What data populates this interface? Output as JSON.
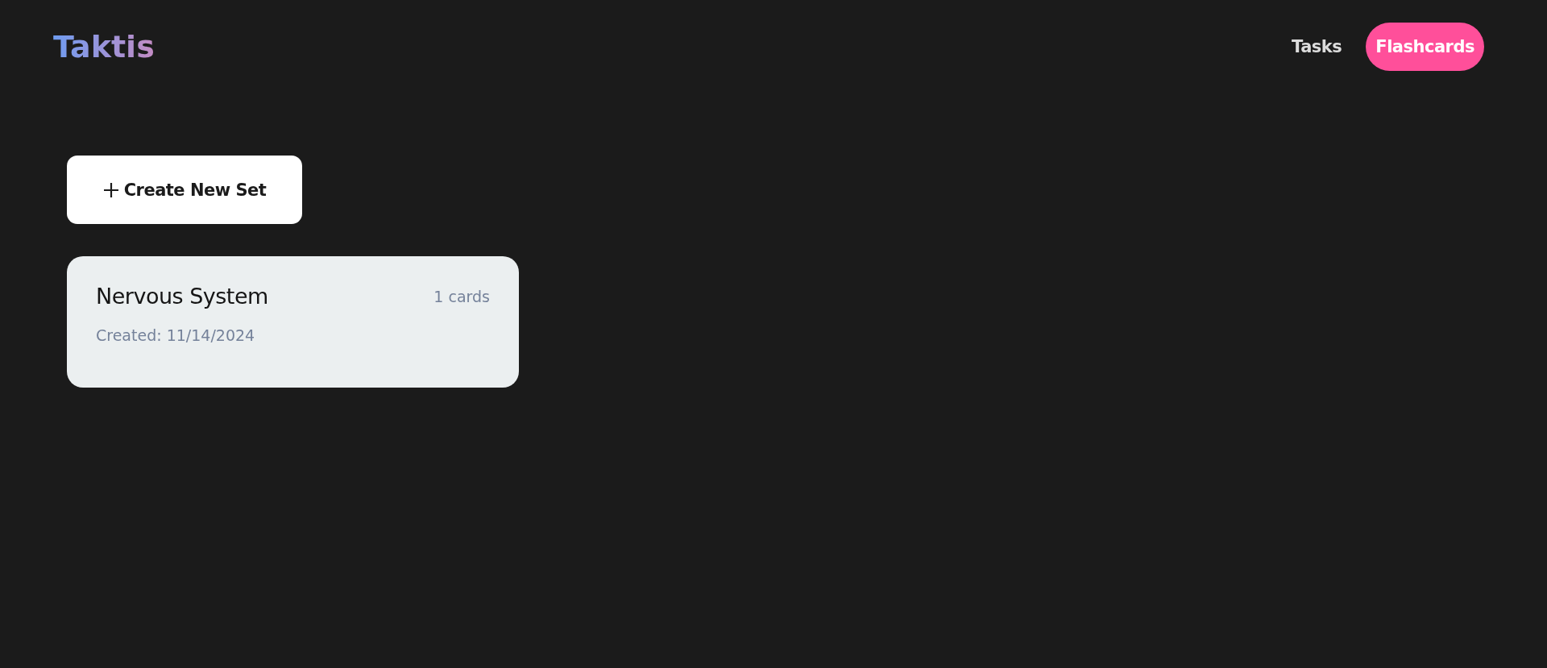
{
  "logo": "Taktis",
  "nav": [
    {
      "label": "Tasks",
      "selected": false
    },
    {
      "label": "Flashcards",
      "selected": true
    }
  ],
  "create_button": {
    "label": "Create New Set"
  },
  "sets": [
    {
      "title": "Nervous System",
      "count": "1 cards",
      "created": "Created: 11/14/2024"
    }
  ]
}
